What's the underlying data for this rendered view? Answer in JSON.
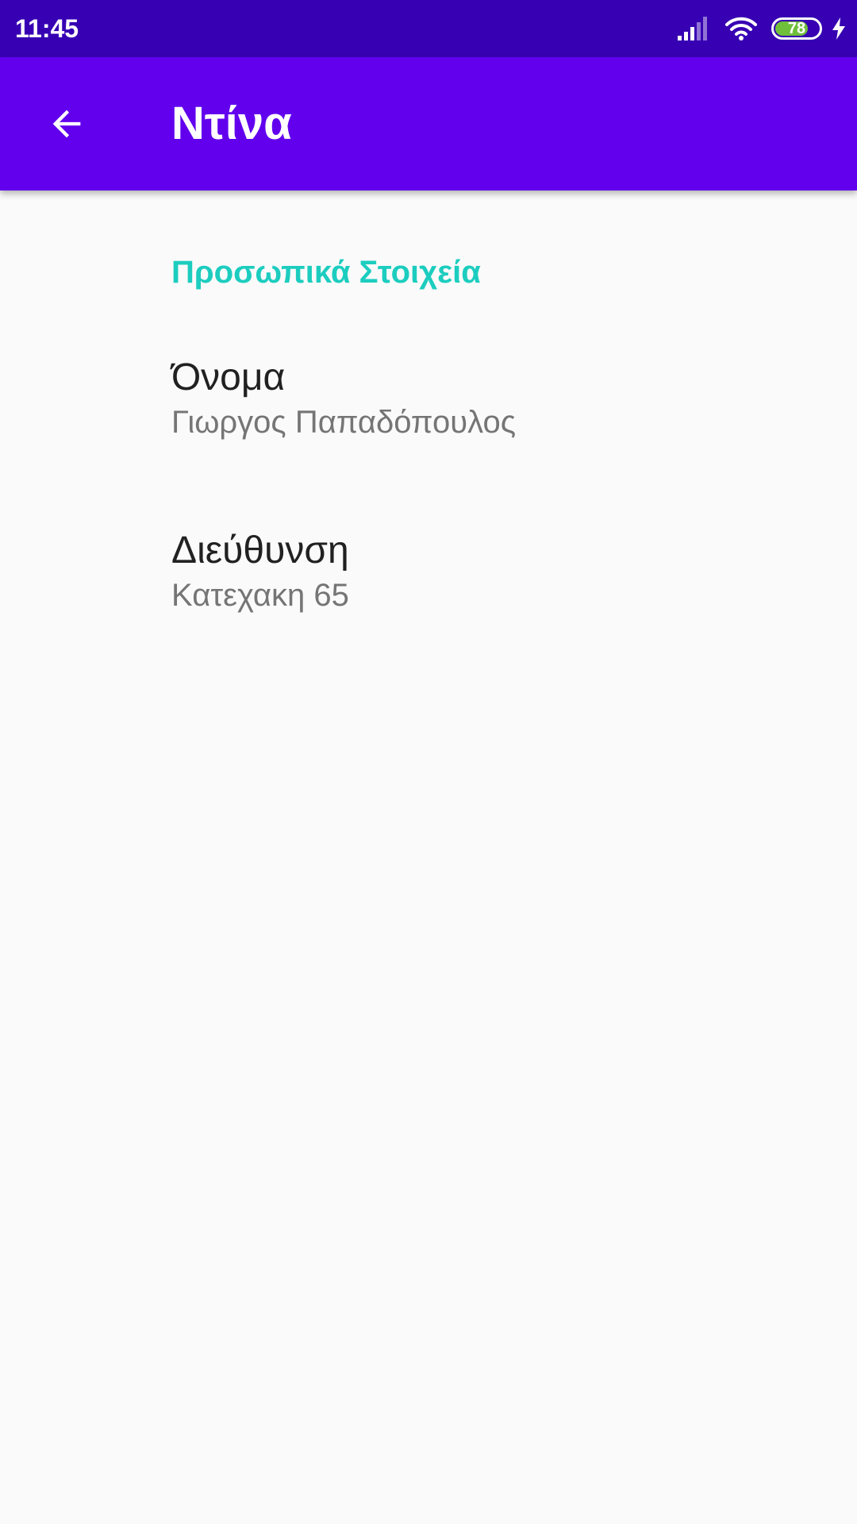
{
  "status_bar": {
    "time": "11:45",
    "battery_percent": 78,
    "battery_label": "78",
    "icons": [
      "signal-icon",
      "wifi-icon",
      "battery-icon",
      "charging-bolt-icon"
    ]
  },
  "app_bar": {
    "back_icon": "arrow-back-icon",
    "title": "Ντίνα"
  },
  "preferences": {
    "section_title": "Προσωπικά Στοιχεία",
    "items": [
      {
        "title": "Όνομα",
        "summary": "Γιωργος Παπαδόπουλος"
      },
      {
        "title": "Διεύθυνση",
        "summary": "Κατεχακη 65"
      }
    ]
  },
  "colors": {
    "status_bar": "#3700b3",
    "app_bar": "#6200ee",
    "accent": "#1ccdbf",
    "background": "#fafafa"
  }
}
